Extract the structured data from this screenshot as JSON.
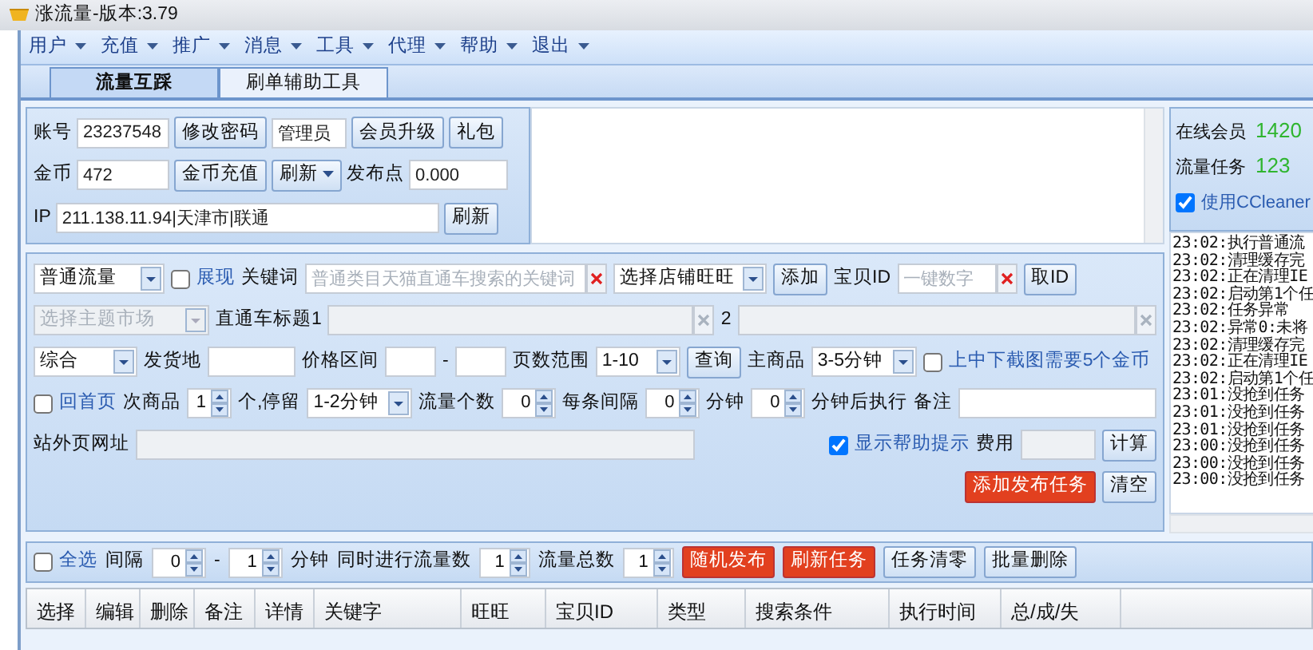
{
  "window": {
    "title": "涨流量-版本:3.79"
  },
  "menu": [
    {
      "label": "用户"
    },
    {
      "label": "充值"
    },
    {
      "label": "推广"
    },
    {
      "label": "消息"
    },
    {
      "label": "工具"
    },
    {
      "label": "代理"
    },
    {
      "label": "帮助"
    },
    {
      "label": "退出"
    }
  ],
  "tabs": [
    {
      "label": "流量互踩",
      "selected": true
    },
    {
      "label": "刷单辅助工具",
      "selected": false
    }
  ],
  "account": {
    "lines": [
      {
        "items": [
          {
            "kind": "label",
            "text": "账号"
          },
          {
            "kind": "field",
            "value": "23237548"
          },
          {
            "kind": "button",
            "label": "修改密码"
          },
          {
            "kind": "field",
            "value": "管理员"
          },
          {
            "kind": "button",
            "label": "会员升级"
          },
          {
            "kind": "button",
            "label": "礼包"
          }
        ]
      },
      {
        "items": [
          {
            "kind": "label",
            "text": "金币"
          },
          {
            "kind": "field",
            "value": "472"
          },
          {
            "kind": "button",
            "label": "金币充值"
          },
          {
            "kind": "dropbutton",
            "label": "刷新"
          },
          {
            "kind": "label",
            "text": "发布点"
          },
          {
            "kind": "field",
            "value": "0.000"
          }
        ]
      },
      {
        "items": [
          {
            "kind": "label",
            "text": "IP"
          },
          {
            "kind": "field",
            "value": "211.138.11.94|天津市|联通"
          },
          {
            "kind": "button",
            "label": "刷新"
          }
        ]
      }
    ]
  },
  "stats": {
    "items": [
      {
        "label": "在线会员",
        "value": "1420"
      },
      {
        "label": "流量任务",
        "value": "123"
      }
    ],
    "ccleaner": {
      "label": "使用CCleaner",
      "checked": true
    }
  },
  "log": [
    "23:02:执行普通流",
    "23:02:清理缓存完",
    "23:02:正在清理IE",
    "23:02:启动第1个任",
    "23:02:任务异常",
    "23:02:异常0:未将",
    "23:02:清理缓存完",
    "23:02:正在清理IE",
    "23:02:启动第1个任",
    "23:01:没抢到任务",
    "23:01:没抢到任务",
    "23:01:没抢到任务",
    "23:00:没抢到任务",
    "23:00:没抢到任务",
    "23:00:没抢到任务"
  ],
  "form": {
    "lines": [
      {
        "items": [
          {
            "kind": "combo",
            "value": "普通流量",
            "disabled": false
          },
          {
            "kind": "check",
            "label": "展现",
            "checked": false
          },
          {
            "kind": "label",
            "text": "关键词"
          },
          {
            "kind": "field",
            "placeholder": "普通类目天猫直通车搜索的关键词",
            "clear": true,
            "disabled": false
          },
          {
            "kind": "combo",
            "value": "选择店铺旺旺",
            "disabled": false
          },
          {
            "kind": "button",
            "label": "添加"
          },
          {
            "kind": "label",
            "text": "宝贝ID"
          },
          {
            "kind": "field",
            "placeholder": "一键数字",
            "clear": true,
            "disabled": false
          },
          {
            "kind": "button",
            "label": "取ID"
          }
        ]
      },
      {
        "items": [
          {
            "kind": "combo",
            "value": "选择主题市场",
            "disabled": true
          },
          {
            "kind": "label",
            "text": "直通车标题1"
          },
          {
            "kind": "field",
            "clear": true,
            "disabled": true
          },
          {
            "kind": "label",
            "text": "2"
          },
          {
            "kind": "field",
            "clear": true,
            "disabled": true
          }
        ]
      },
      {
        "items": [
          {
            "kind": "combo",
            "value": "综合",
            "disabled": false
          },
          {
            "kind": "label",
            "text": "发货地"
          },
          {
            "kind": "field",
            "disabled": false
          },
          {
            "kind": "label",
            "text": "价格区间"
          },
          {
            "kind": "field",
            "disabled": false
          },
          {
            "kind": "label",
            "text": "-"
          },
          {
            "kind": "field",
            "disabled": false
          },
          {
            "kind": "label",
            "text": "页数范围"
          },
          {
            "kind": "combo",
            "value": "1-10",
            "disabled": false
          },
          {
            "kind": "button",
            "label": "查询"
          },
          {
            "kind": "label",
            "text": "主商品"
          },
          {
            "kind": "combo",
            "value": "3-5分钟",
            "disabled": false
          },
          {
            "kind": "check",
            "label": "上中下截图需要5个金币",
            "checked": false
          }
        ]
      },
      {
        "items": [
          {
            "kind": "check",
            "label": "回首页",
            "checked": false
          },
          {
            "kind": "label",
            "text": "次商品"
          },
          {
            "kind": "spin",
            "value": "1"
          },
          {
            "kind": "label",
            "text": "个,停留"
          },
          {
            "kind": "combo",
            "value": "1-2分钟",
            "disabled": false
          },
          {
            "kind": "label",
            "text": "流量个数"
          },
          {
            "kind": "spin",
            "value": "0"
          },
          {
            "kind": "label",
            "text": "每条间隔"
          },
          {
            "kind": "spin",
            "value": "0"
          },
          {
            "kind": "label",
            "text": "分钟"
          },
          {
            "kind": "spin",
            "value": "0"
          },
          {
            "kind": "label",
            "text": "分钟后执行"
          },
          {
            "kind": "label",
            "text": "备注"
          },
          {
            "kind": "field",
            "disabled": false
          }
        ]
      },
      {
        "items": [
          {
            "kind": "label",
            "text": "站外页网址"
          },
          {
            "kind": "field",
            "disabled": true
          },
          {
            "kind": "check",
            "label": "显示帮助提示",
            "checked": true
          },
          {
            "kind": "label",
            "text": "费用"
          },
          {
            "kind": "field",
            "disabled": true
          },
          {
            "kind": "button",
            "label": "计算"
          }
        ]
      },
      {
        "items": [
          {
            "kind": "red",
            "label": "添加发布任务"
          },
          {
            "kind": "button",
            "label": "清空"
          }
        ]
      }
    ]
  },
  "toolbar": [
    {
      "kind": "check",
      "label": "全选",
      "checked": false
    },
    {
      "kind": "label",
      "text": "间隔"
    },
    {
      "kind": "spin",
      "value": "0"
    },
    {
      "kind": "label",
      "text": "-"
    },
    {
      "kind": "spin",
      "value": "1"
    },
    {
      "kind": "label",
      "text": "分钟"
    },
    {
      "kind": "label",
      "text": "同时进行流量数"
    },
    {
      "kind": "spin",
      "value": "1"
    },
    {
      "kind": "label",
      "text": "流量总数"
    },
    {
      "kind": "spin",
      "value": "1"
    },
    {
      "kind": "red",
      "label": "随机发布"
    },
    {
      "kind": "red",
      "label": "刷新任务"
    },
    {
      "kind": "button",
      "label": "任务清零"
    },
    {
      "kind": "button",
      "label": "批量删除"
    }
  ],
  "table": {
    "columns": [
      "选择",
      "编辑",
      "删除",
      "备注",
      "详情",
      "关键字",
      "旺旺",
      "宝贝ID",
      "类型",
      "搜索条件",
      "执行时间",
      "总/成/失"
    ]
  }
}
